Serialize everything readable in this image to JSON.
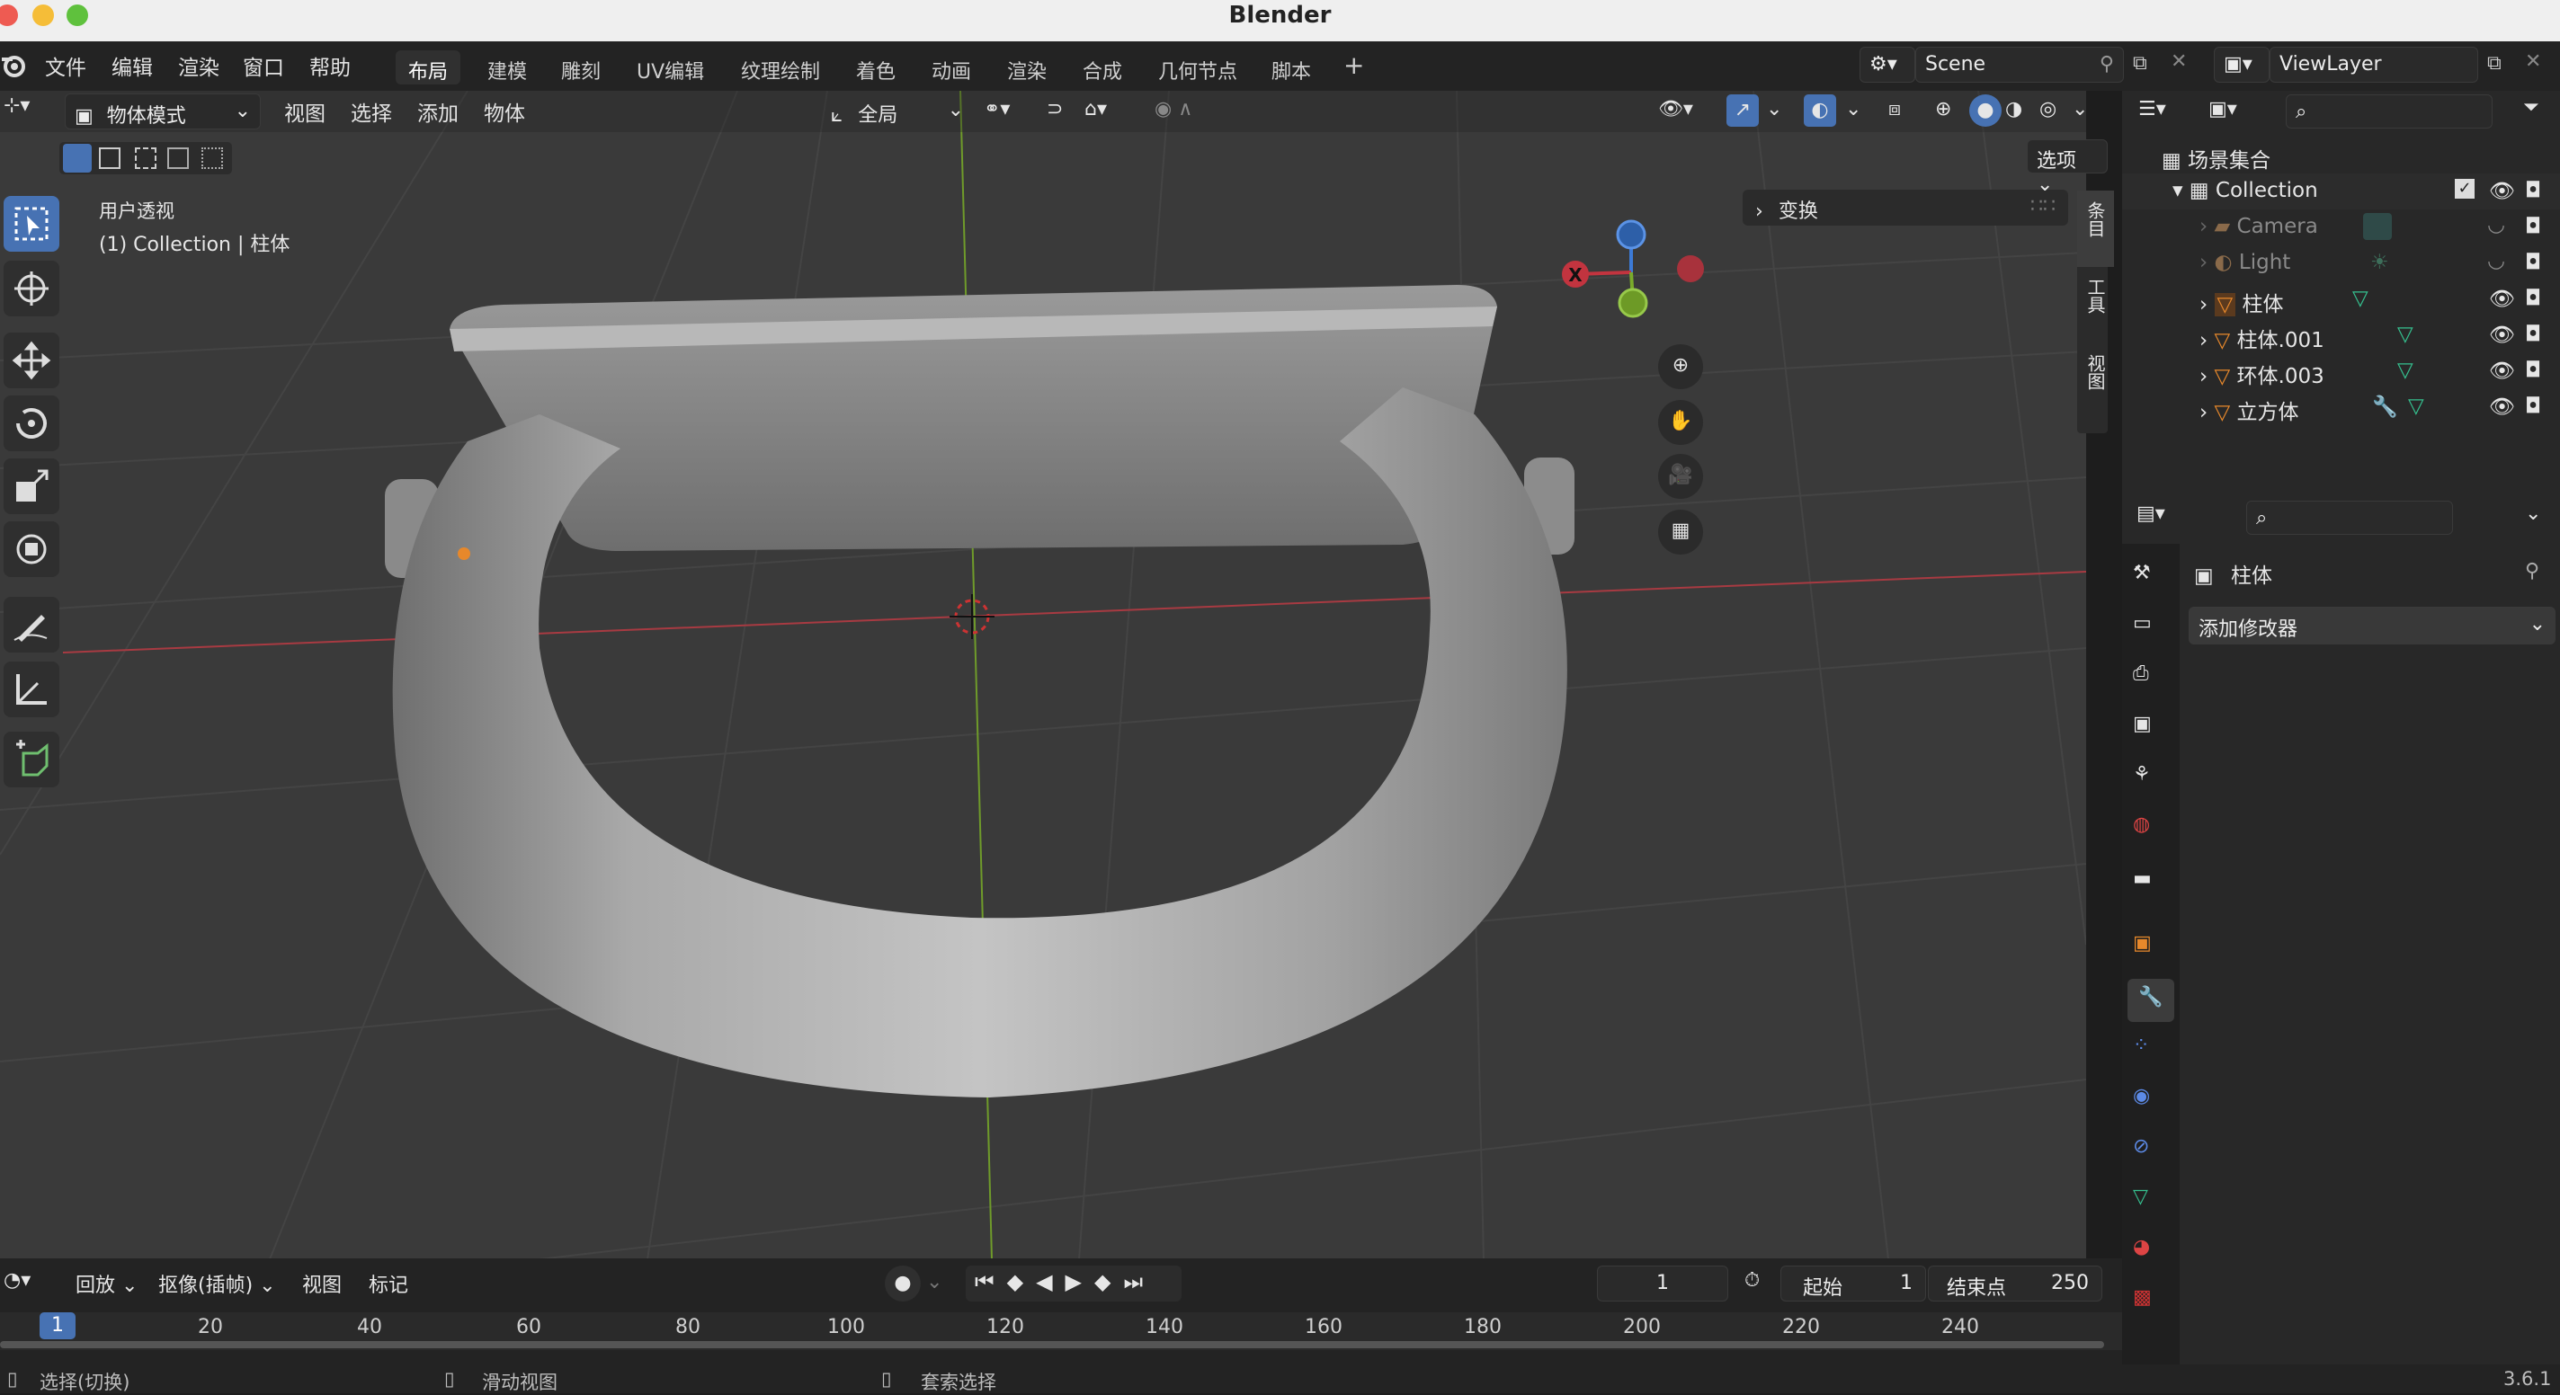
{
  "window": {
    "title": "Blender",
    "version": "3.6.1"
  },
  "menu": [
    "文件",
    "编辑",
    "渲染",
    "窗口",
    "帮助"
  ],
  "workspaces": [
    "布局",
    "建模",
    "雕刻",
    "UV编辑",
    "纹理绘制",
    "着色",
    "动画",
    "渲染",
    "合成",
    "几何节点",
    "脚本"
  ],
  "add_workspace": "+",
  "scene": {
    "name": "Scene"
  },
  "view_layer": {
    "name": "ViewLayer"
  },
  "viewport_header": {
    "mode": "物体模式",
    "menus": [
      "视图",
      "选择",
      "添加",
      "物体"
    ],
    "transform_orientation": "全局",
    "options": "选项"
  },
  "viewport": {
    "view_name": "用户透视",
    "collection_line": "(1) Collection | 柱体",
    "sidebar_section": "变换",
    "sidebar_tabs": [
      "条目",
      "工具",
      "视图"
    ],
    "gizmo_x_label": "X"
  },
  "outliner": {
    "root": "场景集合",
    "collection": "Collection",
    "items": [
      {
        "name": "Camera",
        "dim": true
      },
      {
        "name": "Light",
        "dim": true
      },
      {
        "name": "柱体",
        "dim": false
      },
      {
        "name": "柱体.001",
        "dim": false
      },
      {
        "name": "环体.003",
        "dim": false
      },
      {
        "name": "立方体",
        "dim": false
      }
    ]
  },
  "properties": {
    "object_name": "柱体",
    "add_modifier": "添加修改器"
  },
  "timeline": {
    "playback": "回放",
    "keying": "抠像(插帧)",
    "view": "视图",
    "marker": "标记",
    "current_frame": "1",
    "start_label": "起始",
    "start": "1",
    "end_label": "结束点",
    "end": "250",
    "ticks": [
      "1",
      "20",
      "40",
      "60",
      "80",
      "100",
      "120",
      "140",
      "160",
      "180",
      "200",
      "220",
      "240"
    ]
  },
  "status": {
    "select": "选择(切换)",
    "pan": "滑动视图",
    "lasso": "套索选择"
  },
  "colors": {
    "x_axis": "#c2343f",
    "y_axis": "#7aab2b",
    "z_axis": "#3c7ad6",
    "accent": "#4772b3",
    "active_object": "#e7882b"
  }
}
